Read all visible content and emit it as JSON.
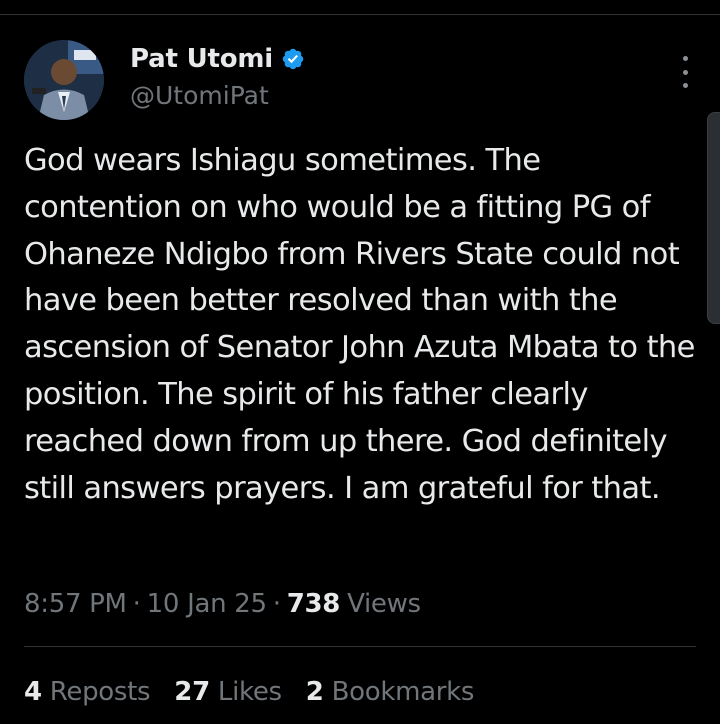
{
  "author": {
    "display_name": "Pat Utomi",
    "handle": "@UtomiPat",
    "verified": true,
    "avatar_icon": "profile-photo",
    "verified_icon": "verified-badge-icon"
  },
  "tweet": {
    "text": "God wears Ishiagu sometimes. The contention on who would be a fitting PG of Ohaneze Ndigbo from Rivers State could not have been better resolved than with the ascension of Senator John Azuta Mbata to the position.  The spirit of his father clearly reached down from up there. God definitely still answers prayers. I am grateful for that."
  },
  "meta": {
    "time": "8:57 PM",
    "separator": "·",
    "date": "10 Jan 25",
    "views_count": "738",
    "views_label": "Views"
  },
  "stats": {
    "reposts_count": "4",
    "reposts_label": "Reposts",
    "likes_count": "27",
    "likes_label": "Likes",
    "bookmarks_count": "2",
    "bookmarks_label": "Bookmarks"
  },
  "colors": {
    "background": "#000000",
    "primary_text": "#e7e9ea",
    "secondary_text": "#71767b",
    "verified_blue": "#1d9bf0",
    "divider": "#2f3336"
  },
  "icons": {
    "more": "more-vertical-icon"
  }
}
